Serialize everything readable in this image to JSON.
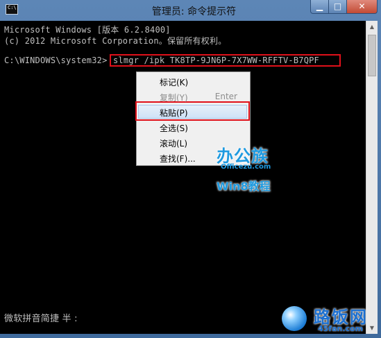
{
  "window": {
    "title": "管理员: 命令提示符",
    "icon_text": "C:\\"
  },
  "console": {
    "lines": [
      "Microsoft Windows [版本 6.2.8400]",
      "(c) 2012 Microsoft Corporation。保留所有权利。"
    ],
    "prompt": "C:\\WINDOWS\\system32>",
    "command": "slmgr /ipk TK8TP-9JN6P-7X7WW-RFFTV-B7QPF",
    "ime_status": "微软拼音简捷 半 :"
  },
  "context_menu": {
    "items": [
      {
        "label": "标记(K)",
        "accel": "",
        "state": "normal"
      },
      {
        "label": "复制(Y)",
        "accel": "Enter",
        "state": "disabled"
      },
      {
        "label": "粘贴(P)",
        "accel": "",
        "state": "selected"
      },
      {
        "label": "全选(S)",
        "accel": "",
        "state": "normal"
      },
      {
        "label": "滚动(L)",
        "accel": "",
        "state": "normal"
      },
      {
        "label": "查找(F)...",
        "accel": "",
        "state": "normal"
      }
    ]
  },
  "watermarks": {
    "logo1_main": "办公族",
    "logo1_sub": "Officezu.com",
    "logo2": "Win8教程",
    "logo3_cn": "路饭网",
    "logo3_en": "45fan.com"
  },
  "colors": {
    "highlight_border": "#e0101a",
    "console_bg": "#000000",
    "console_text": "#c0c0c0",
    "titlebar": "#5d86b6"
  }
}
